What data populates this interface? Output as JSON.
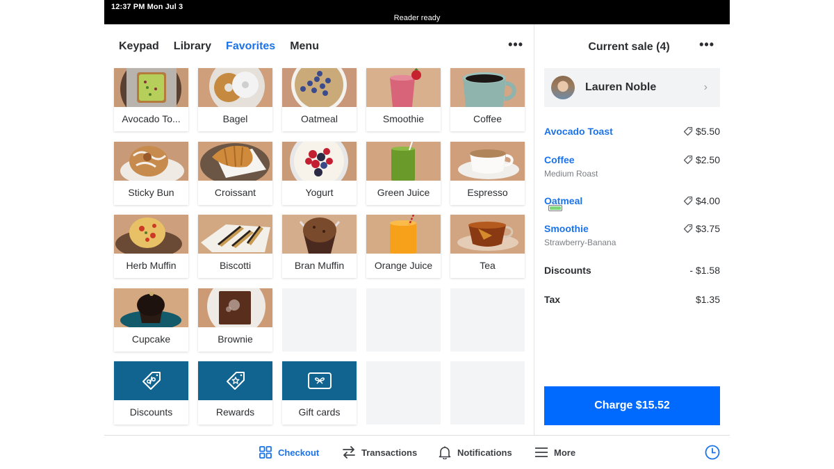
{
  "status_bar": {
    "time": "12:37 PM  Mon Jul 3",
    "reader_status": "Reader ready",
    "icons": [
      "wifi-icon",
      "battery-icon",
      "charging-bolt-icon"
    ]
  },
  "left_panel": {
    "tabs": [
      {
        "label": "Keypad",
        "active": false
      },
      {
        "label": "Library",
        "active": false
      },
      {
        "label": "Favorites",
        "active": true
      },
      {
        "label": "Menu",
        "active": false
      }
    ],
    "more_label": "•••",
    "tiles": [
      {
        "label": "Avocado To...",
        "type": "item",
        "image": "avocado-toast"
      },
      {
        "label": "Bagel",
        "type": "item",
        "image": "bagel"
      },
      {
        "label": "Oatmeal",
        "type": "item",
        "image": "oatmeal"
      },
      {
        "label": "Smoothie",
        "type": "item",
        "image": "smoothie"
      },
      {
        "label": "Coffee",
        "type": "item",
        "image": "coffee"
      },
      {
        "label": "Sticky Bun",
        "type": "item",
        "image": "sticky-bun"
      },
      {
        "label": "Croissant",
        "type": "item",
        "image": "croissant"
      },
      {
        "label": "Yogurt",
        "type": "item",
        "image": "yogurt"
      },
      {
        "label": "Green Juice",
        "type": "item",
        "image": "green-juice"
      },
      {
        "label": "Espresso",
        "type": "item",
        "image": "espresso"
      },
      {
        "label": "Herb Muffin",
        "type": "item",
        "image": "herb-muffin"
      },
      {
        "label": "Biscotti",
        "type": "item",
        "image": "biscotti"
      },
      {
        "label": "Bran Muffin",
        "type": "item",
        "image": "bran-muffin"
      },
      {
        "label": "Orange Juice",
        "type": "item",
        "image": "orange-juice"
      },
      {
        "label": "Tea",
        "type": "item",
        "image": "tea"
      },
      {
        "label": "Cupcake",
        "type": "item",
        "image": "cupcake"
      },
      {
        "label": "Brownie",
        "type": "item",
        "image": "brownie"
      },
      {
        "label": "",
        "type": "empty"
      },
      {
        "label": "",
        "type": "empty"
      },
      {
        "label": "",
        "type": "empty"
      },
      {
        "label": "Discounts",
        "type": "action",
        "icon": "discount-tag-icon"
      },
      {
        "label": "Rewards",
        "type": "action",
        "icon": "reward-tag-icon"
      },
      {
        "label": "Gift cards",
        "type": "action",
        "icon": "gift-card-icon"
      },
      {
        "label": "",
        "type": "empty"
      },
      {
        "label": "",
        "type": "empty"
      }
    ]
  },
  "right_panel": {
    "title": "Current sale (4)",
    "more_label": "•••",
    "customer": {
      "name": "Lauren Noble"
    },
    "line_items": [
      {
        "name": "Avocado Toast",
        "modifier": "",
        "price": "$5.50"
      },
      {
        "name": "Coffee",
        "modifier": "Medium Roast",
        "price": "$2.50"
      },
      {
        "name": "Oatmeal",
        "modifier": "",
        "price": "$4.00"
      },
      {
        "name": "Smoothie",
        "modifier": "Strawberry-Banana",
        "price": "$3.75"
      }
    ],
    "discounts": {
      "label": "Discounts",
      "value": "- $1.58"
    },
    "tax": {
      "label": "Tax",
      "value": "$1.35"
    },
    "charge_label": "Charge $15.52"
  },
  "bottom_nav": {
    "items": [
      {
        "label": "Checkout",
        "icon": "grid-icon",
        "active": true
      },
      {
        "label": "Transactions",
        "icon": "transfer-arrows-icon",
        "active": false
      },
      {
        "label": "Notifications",
        "icon": "bell-icon",
        "active": false
      },
      {
        "label": "More",
        "icon": "hamburger-menu-icon",
        "active": false
      }
    ],
    "clock_icon": "clock-icon"
  },
  "colors": {
    "accent_blue": "#1a73e8",
    "charge_button": "#006aff",
    "action_tile": "#11648f",
    "empty_tile": "#f2f4f5"
  }
}
